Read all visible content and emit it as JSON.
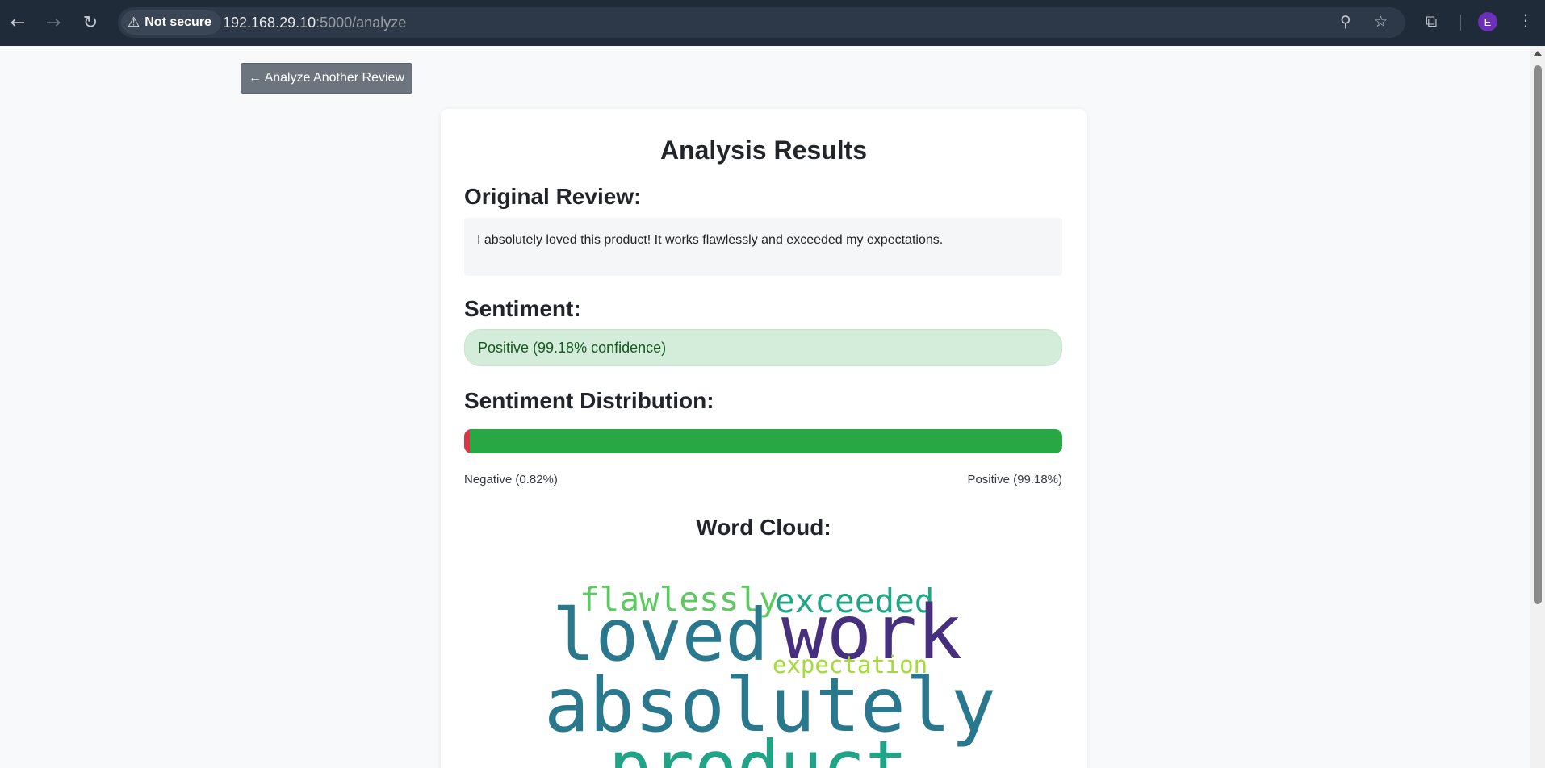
{
  "browser": {
    "security_label": "Not secure",
    "url_host": "192.168.29.10",
    "url_path": ":5000/analyze",
    "profile_initial": "E"
  },
  "page": {
    "back_button": "← Analyze Another Review",
    "title": "Analysis Results",
    "review_heading": "Original Review:",
    "review_text": "I absolutely loved this product! It works flawlessly and exceeded my expectations.",
    "sentiment_heading": "Sentiment:",
    "sentiment_text": "Positive (99.18% confidence)",
    "distribution_heading": "Sentiment Distribution:",
    "distribution": {
      "negative_label": "Negative (0.82%)",
      "positive_label": "Positive (99.18%)",
      "negative_pct": 0.82,
      "positive_pct": 99.18,
      "negative_color": "#dc3545",
      "positive_color": "#28a745"
    },
    "wordcloud_heading": "Word Cloud:",
    "wordcloud": {
      "w_flawlessly": "flawlessly",
      "w_exceeded": "exceeded",
      "w_loved": "loved",
      "w_work": "work",
      "w_expectation": "expectation",
      "w_absolutely": "absolutely",
      "w_product": "product",
      "colors": {
        "flawlessly": "#5ec962",
        "exceeded": "#21a685",
        "loved": "#2a788e",
        "work": "#46307e",
        "expectation": "#a5db36",
        "absolutely": "#2a788e",
        "product": "#20a386"
      }
    }
  },
  "icons": [
    "back-arrow-icon",
    "forward-arrow-icon",
    "reload-icon",
    "warning-icon",
    "zoom-icon",
    "star-icon",
    "extensions-icon",
    "menu-icon"
  ]
}
